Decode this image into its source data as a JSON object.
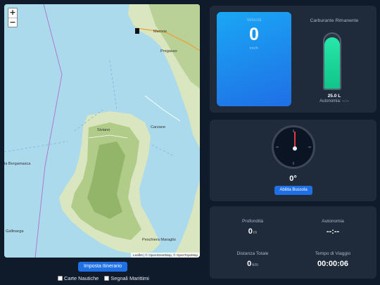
{
  "map": {
    "zoom_in": "+",
    "zoom_out": "−",
    "labels": {
      "marone": "Marone",
      "pregasso": "Pregasso",
      "carzano": "Carzano",
      "siviano": "Siviano",
      "bergamasca": "la Bergamasca",
      "gallinarga": "Gallinarga",
      "peschiera": "Peschiera Maraglio"
    },
    "attribution": "Leaflet | © OpenStreetMap, © OpenTopoMap",
    "colors": {
      "water": "#aadaec",
      "land": "#d9e6c0",
      "forest": "#9fbf72",
      "route": "#b07ad0"
    }
  },
  "controls": {
    "route_button": "Imposta Itinerario",
    "checkbox_nautical": "Carte Nautiche",
    "checkbox_marks": "Segnali Marittimi"
  },
  "speed": {
    "label": "Velocità",
    "value": "0",
    "unit": "km/h"
  },
  "fuel": {
    "title": "Carburante Rimanente",
    "value": "25.0 L",
    "autonomy": "Autonomia: --:--",
    "level_fraction": 0.93
  },
  "compass": {
    "heading": "0°",
    "button": "Abilita Bussola"
  },
  "stats": {
    "depth": {
      "label": "Profondità",
      "value": "0",
      "unit": "m"
    },
    "autonomy": {
      "label": "Autonomia",
      "value": "--:--"
    },
    "distance": {
      "label": "Distanza Totale",
      "value": "0",
      "unit": "km"
    },
    "travel_time": {
      "label": "Tempo di Viaggio",
      "value": "00:00:06"
    }
  }
}
